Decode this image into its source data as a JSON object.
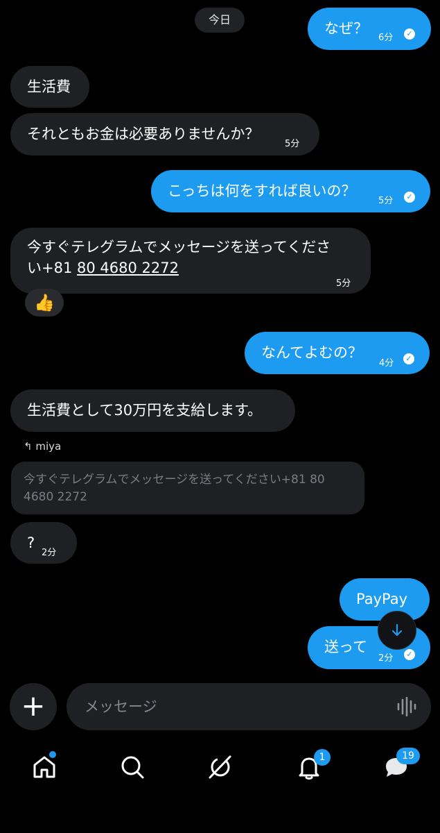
{
  "date_label": "今日",
  "messages": {
    "m1": {
      "text": "なぜ？",
      "time": "6分"
    },
    "m2": {
      "text": "生活費"
    },
    "m3": {
      "text": "それともお金は必要ありませんか？",
      "time": "5分"
    },
    "m4": {
      "text": "こっちは何をすれば良いの？",
      "time": "5分"
    },
    "m5": {
      "line1": "今すぐテレグラムでメッセージを送ってくださ",
      "line2_prefix": "い+81 ",
      "phone_link": "80 4680 2272",
      "time": "5分",
      "reaction": "👍"
    },
    "m6": {
      "text": "なんてよむの？",
      "time": "4分"
    },
    "m7": {
      "text": "生活費として30万円を支給します。"
    },
    "m8": {
      "reply_label": "miya",
      "quote": "今すぐテレグラムでメッセージを送ってください+81 80 4680 2272"
    },
    "m9": {
      "text": "?",
      "time": "2分"
    },
    "m10": {
      "text": "PayPay"
    },
    "m11": {
      "text": "送って",
      "time": "2分"
    }
  },
  "composer": {
    "placeholder": "メッセージ"
  },
  "nav": {
    "notifications_badge": "1",
    "messages_badge": "19"
  },
  "colors": {
    "accent": "#1d9bf0",
    "received_bubble": "#1f2023",
    "background": "#000000"
  }
}
